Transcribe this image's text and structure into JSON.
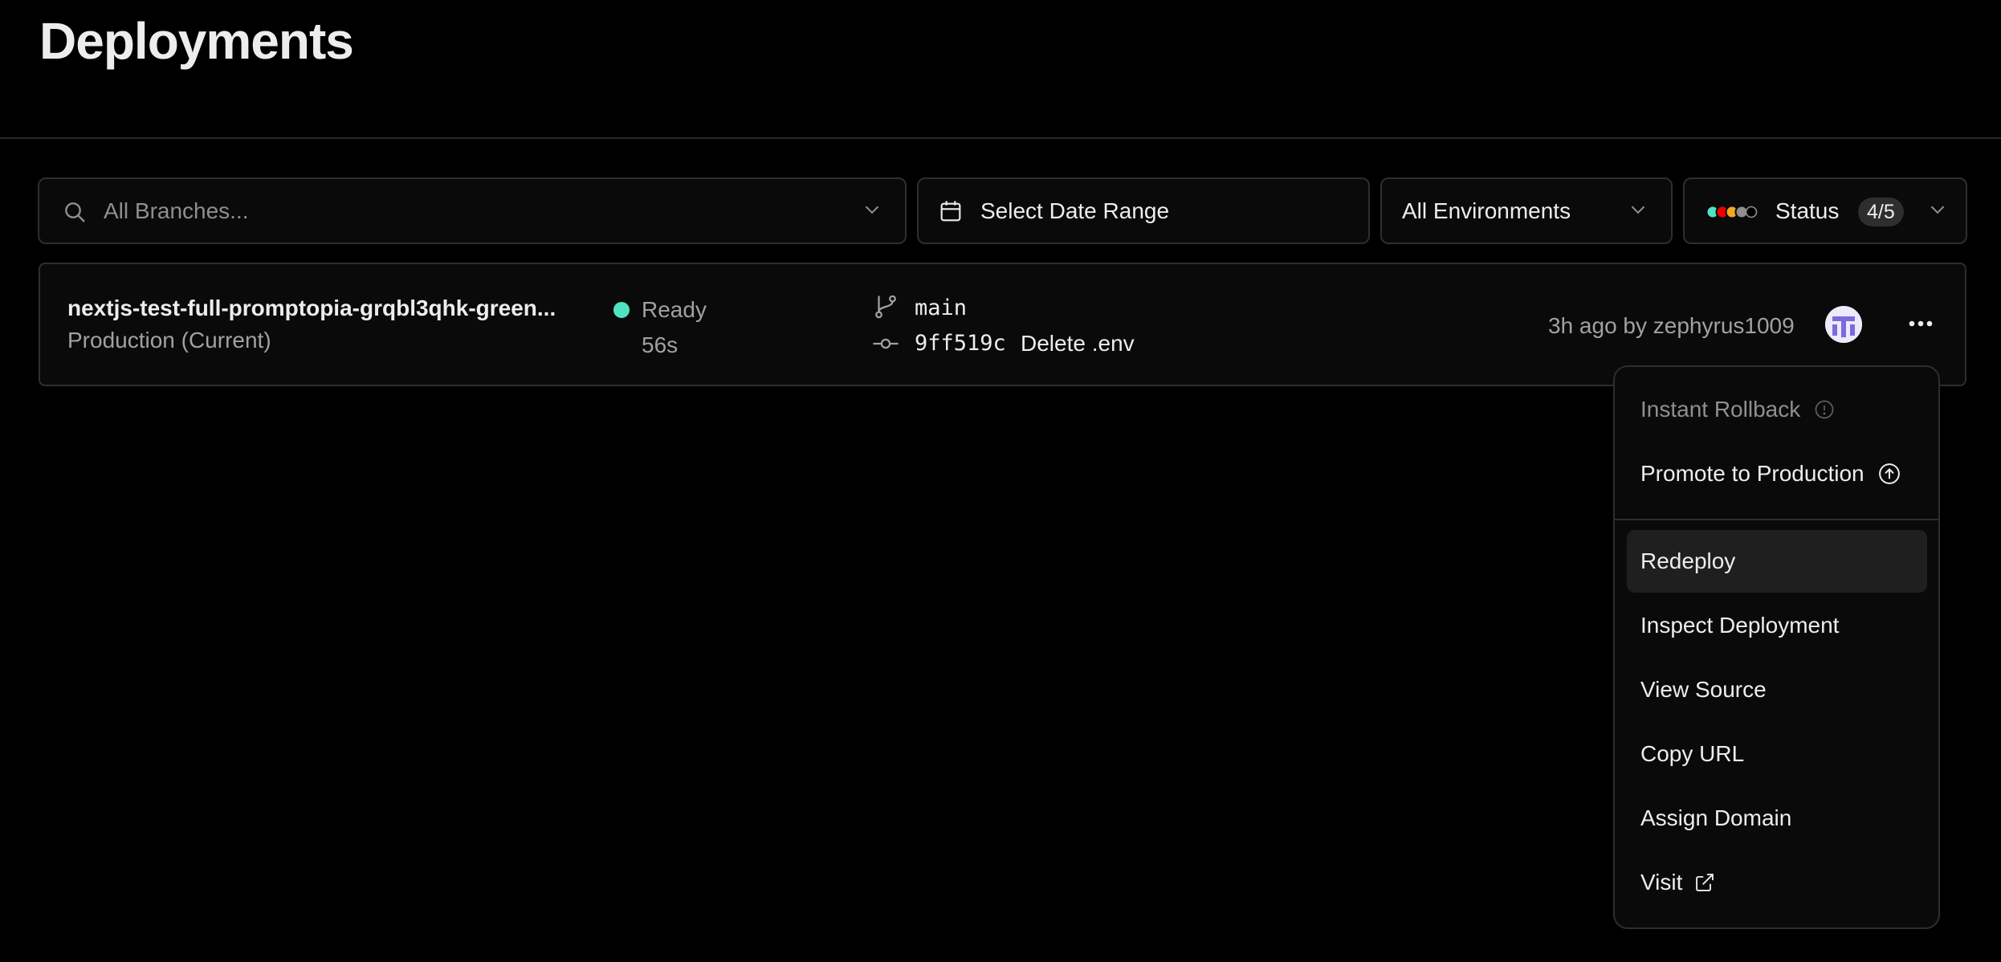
{
  "page": {
    "title": "Deployments"
  },
  "filters": {
    "branches_placeholder": "All Branches...",
    "date_range_label": "Select Date Range",
    "environments_label": "All Environments",
    "status_label": "Status",
    "status_count": "4/5",
    "status_dot_colors": [
      "#50e3c2",
      "#ee0000",
      "#f5a623",
      "#8f8f8f",
      "#000000"
    ]
  },
  "deployment": {
    "name": "nextjs-test-full-promptopia-grqbl3qhk-green...",
    "environment": "Production (Current)",
    "status": "Ready",
    "status_color": "#50e3c2",
    "duration": "56s",
    "branch": "main",
    "commit_hash": "9ff519c",
    "commit_message": "Delete .env",
    "meta": "3h ago by zephyrus1009"
  },
  "menu": {
    "items": [
      {
        "label": "Instant Rollback",
        "icon": "info-icon",
        "disabled": true
      },
      {
        "label": "Promote to Production",
        "icon": "arrow-up-circle-icon",
        "disabled": false
      },
      {
        "label": "Redeploy",
        "active": true
      },
      {
        "label": "Inspect Deployment"
      },
      {
        "label": "View Source"
      },
      {
        "label": "Copy URL"
      },
      {
        "label": "Assign Domain"
      },
      {
        "label": "Visit",
        "icon": "external-link-icon"
      }
    ]
  }
}
